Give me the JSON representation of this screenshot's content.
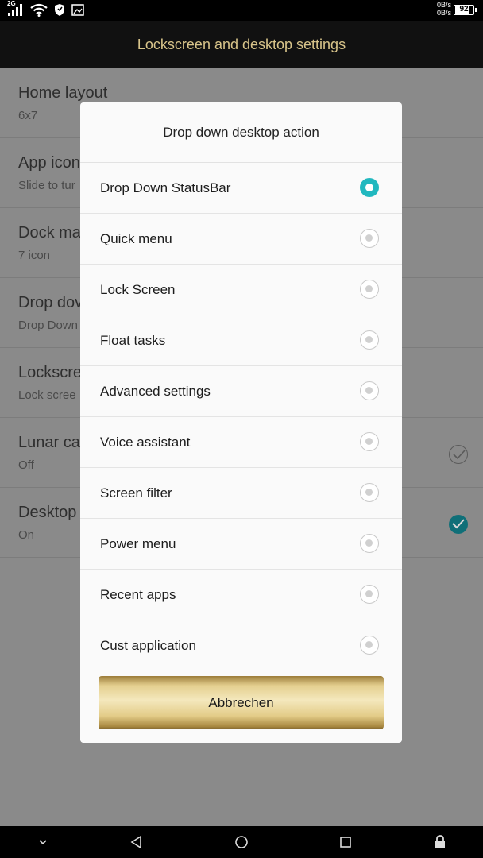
{
  "status_bar": {
    "network": "2G",
    "speed_up": "0B/s",
    "speed_down": "0B/s",
    "battery": "92",
    "icons": [
      "signal-icon",
      "wifi-icon",
      "shield-icon",
      "image-icon",
      "battery-icon"
    ]
  },
  "header": {
    "title": "Lockscreen and desktop settings"
  },
  "settings": [
    {
      "title": "Home layout",
      "subtitle": "6x7",
      "check": "none"
    },
    {
      "title": "App icon",
      "subtitle": "Slide to tur",
      "check": "none"
    },
    {
      "title": "Dock ma",
      "subtitle": "7 icon",
      "check": "none"
    },
    {
      "title": "Drop dov",
      "subtitle": "Drop Down",
      "check": "none"
    },
    {
      "title": "Lockscre",
      "subtitle": "Lock scree",
      "check": "none"
    },
    {
      "title": "Lunar ca",
      "subtitle": "Off",
      "check": "off"
    },
    {
      "title": "Desktop",
      "subtitle": "On",
      "check": "on"
    }
  ],
  "dialog": {
    "title": "Drop down desktop action",
    "options": [
      {
        "label": "Drop Down StatusBar",
        "selected": true
      },
      {
        "label": "Quick menu",
        "selected": false
      },
      {
        "label": "Lock Screen",
        "selected": false
      },
      {
        "label": "Float tasks",
        "selected": false
      },
      {
        "label": "Advanced settings",
        "selected": false
      },
      {
        "label": "Voice assistant",
        "selected": false
      },
      {
        "label": "Screen filter",
        "selected": false
      },
      {
        "label": "Power menu",
        "selected": false
      },
      {
        "label": "Recent apps",
        "selected": false
      },
      {
        "label": "Cust application",
        "selected": false
      }
    ],
    "cancel_label": "Abbrechen"
  },
  "nav_bar": {
    "icons": [
      "chevron-down-icon",
      "back-icon",
      "home-icon",
      "recents-icon",
      "lock-icon"
    ]
  },
  "colors": {
    "accent": "#21b8bf",
    "title_text": "#d8c48a",
    "gold": "#e3cc88"
  }
}
